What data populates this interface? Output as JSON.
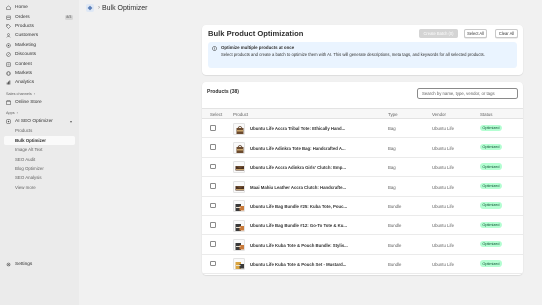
{
  "sidebar": {
    "nav": [
      {
        "label": "Home",
        "icon": "home-icon"
      },
      {
        "label": "Orders",
        "icon": "orders-icon",
        "badge": "8/3"
      },
      {
        "label": "Products",
        "icon": "tag-icon"
      },
      {
        "label": "Customers",
        "icon": "person-icon"
      },
      {
        "label": "Marketing",
        "icon": "target-icon"
      },
      {
        "label": "Discounts",
        "icon": "discount-icon"
      },
      {
        "label": "Content",
        "icon": "content-icon"
      },
      {
        "label": "Markets",
        "icon": "globe-icon"
      },
      {
        "label": "Analytics",
        "icon": "chart-icon"
      }
    ],
    "sales_channels_label": "Sales channels",
    "online_store_label": "Online Store",
    "apps_label": "Apps",
    "app_name": "AI SEO Optimizer",
    "app_subitems": [
      "Products",
      "Bulk Optimizer",
      "Image Alt Text",
      "SEO Audit",
      "Blog Optimizer",
      "SEO Analysis",
      "View more"
    ],
    "active_subitem": "Bulk Optimizer",
    "settings_label": "Settings"
  },
  "topbar": {
    "breadcrumb": "Bulk Optimizer"
  },
  "header_card": {
    "title": "Bulk Product Optimization",
    "create_batch_label": "Create Batch (0)",
    "select_all_label": "Select All",
    "clear_all_label": "Clear All",
    "banner_title": "Optimize multiple products at once",
    "banner_text": "Select products and create a batch to optimize them with AI. This will generate descriptions, meta tags, and keywords for all selected products."
  },
  "products": {
    "title": "Products (38)",
    "search_placeholder": "Search by name, type, vendor, or tags",
    "columns": {
      "select": "Select",
      "product": "Product",
      "type": "Type",
      "vendor": "Vendor",
      "status": "Status"
    },
    "rows": [
      {
        "name": "Ubuntu Life Accra Tribal Tote: Ethically Hand...",
        "type": "Bag",
        "vendor": "Ubuntu Life",
        "status": "Optimized",
        "thumb": "tote"
      },
      {
        "name": "Ubuntu Life Adinkra Tote Bag: Handcrafted A...",
        "type": "Bag",
        "vendor": "Ubuntu Life",
        "status": "Optimized",
        "thumb": "tote"
      },
      {
        "name": "Ubuntu Life Accra Adinkra Girls' Clutch: Emp...",
        "type": "Bag",
        "vendor": "Ubuntu Life",
        "status": "Optimized",
        "thumb": "clutch"
      },
      {
        "name": "Maai Mahiu Leather Accra Clutch: Handcrafte...",
        "type": "Bag",
        "vendor": "Ubuntu Life",
        "status": "Optimized",
        "thumb": "clutch"
      },
      {
        "name": "Ubuntu Life Bag Bundle #25: Kuba Tote, Pouc...",
        "type": "Bundle",
        "vendor": "Ubuntu Life",
        "status": "Optimized",
        "thumb": "bundle"
      },
      {
        "name": "Ubuntu Life Bag Bundle #12: Go-To Tote & Ku...",
        "type": "Bundle",
        "vendor": "Ubuntu Life",
        "status": "Optimized",
        "thumb": "bundle"
      },
      {
        "name": "Ubuntu Life Kuba Tote & Pouch Bundle: Stylis...",
        "type": "Bundle",
        "vendor": "Ubuntu Life",
        "status": "Optimized",
        "thumb": "bundle"
      },
      {
        "name": "Ubuntu Life Kuba Tote & Pouch Set - Mustard...",
        "type": "Bundle",
        "vendor": "Ubuntu Life",
        "status": "Optimized",
        "thumb": "bundle2"
      }
    ]
  },
  "colors": {
    "sidebar_bg": "#ebebeb",
    "page_bg": "#f1f1f1",
    "banner_bg": "#eaf4ff",
    "status_bg": "#b4fed2",
    "status_text": "#0c5132"
  }
}
